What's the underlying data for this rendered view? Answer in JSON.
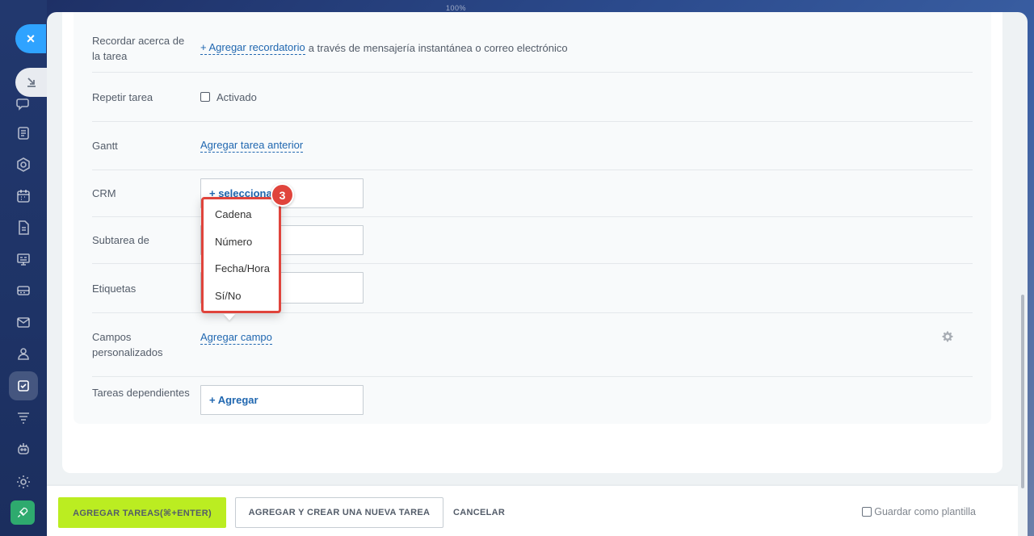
{
  "window": {
    "top_badge": "100%"
  },
  "rail": {
    "close_label": "×",
    "items": [
      {
        "name": "chat-icon"
      },
      {
        "name": "feed-icon"
      },
      {
        "name": "workgroups-icon"
      },
      {
        "name": "calendar-icon"
      },
      {
        "name": "documents-icon"
      },
      {
        "name": "boards-icon"
      },
      {
        "name": "drive-icon"
      },
      {
        "name": "mail-icon"
      },
      {
        "name": "contacts-icon"
      },
      {
        "name": "tasks-icon"
      },
      {
        "name": "filter-icon"
      },
      {
        "name": "robot-icon"
      },
      {
        "name": "settings-icon"
      }
    ]
  },
  "form": {
    "reminder": {
      "label": "Recordar acerca de la tarea",
      "link": "+ Agregar recordatorio",
      "suffix": "a través de mensajería instantánea o correo electrónico"
    },
    "repeat": {
      "label": "Repetir tarea",
      "checkbox_label": "Activado"
    },
    "gantt": {
      "label": "Gantt",
      "link": "Agregar tarea anterior"
    },
    "crm": {
      "label": "CRM",
      "button": "+ seleccionar"
    },
    "subtask": {
      "label": "Subtarea de"
    },
    "tags": {
      "label": "Etiquetas"
    },
    "custom_fields": {
      "label": "Campos personalizados",
      "link": "Agregar campo"
    },
    "dependent": {
      "label": "Tareas dependientes",
      "button": "+ Agregar"
    }
  },
  "popup": {
    "step": "3",
    "items": [
      "Cadena",
      "Número",
      "Fecha/Hora",
      "Sí/No"
    ]
  },
  "footer": {
    "primary": "AGREGAR TAREAS(⌘+ENTER)",
    "secondary": "AGREGAR Y CREAR UNA NUEVA TAREA",
    "cancel": "CANCELAR",
    "save_template": "Guardar como plantilla"
  },
  "colors": {
    "accent": "#2067b0",
    "primary_button": "#bbed21",
    "highlight": "#e0443c"
  }
}
